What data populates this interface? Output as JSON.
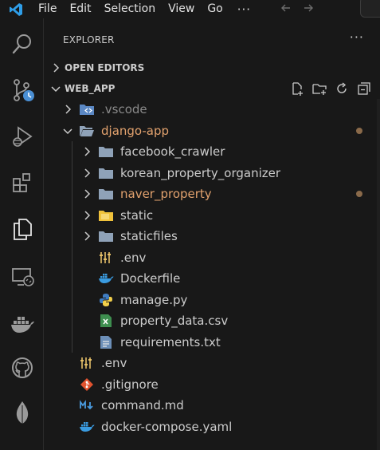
{
  "menu": {
    "items": [
      "File",
      "Edit",
      "Selection",
      "View",
      "Go"
    ],
    "more": "···",
    "back_icon": "arrow-left-icon",
    "forward_icon": "arrow-right-icon"
  },
  "activity_bar": {
    "items": [
      "search-icon",
      "source-control-icon",
      "run-debug-icon",
      "extensions-icon",
      "explorer-icon",
      "remote-explorer-icon",
      "docker-icon",
      "github-icon",
      "mongodb-icon"
    ]
  },
  "sidebar": {
    "title": "EXPLORER",
    "more": "···",
    "open_editors": "OPEN EDITORS",
    "workspace": "WEB_APP"
  },
  "tree": [
    {
      "label": ".vscode",
      "icon": "vscode-folder-icon",
      "depth": 1,
      "type": "folder",
      "expanded": false,
      "style": "dim"
    },
    {
      "label": "django-app",
      "icon": "folder-open-icon",
      "depth": 1,
      "type": "folder",
      "expanded": true,
      "style": "modified",
      "dot": true
    },
    {
      "label": "facebook_crawler",
      "icon": "folder-icon",
      "depth": 2,
      "type": "folder",
      "expanded": false
    },
    {
      "label": "korean_property_organizer",
      "icon": "folder-icon",
      "depth": 2,
      "type": "folder",
      "expanded": false
    },
    {
      "label": "naver_property",
      "icon": "folder-icon",
      "depth": 2,
      "type": "folder",
      "expanded": false,
      "style": "modified",
      "dot": true
    },
    {
      "label": "static",
      "icon": "static-folder-icon",
      "depth": 2,
      "type": "folder",
      "expanded": false
    },
    {
      "label": "staticfiles",
      "icon": "folder-icon",
      "depth": 2,
      "type": "folder",
      "expanded": false
    },
    {
      "label": ".env",
      "icon": "env-icon",
      "depth": 2,
      "type": "file"
    },
    {
      "label": "Dockerfile",
      "icon": "docker-file-icon",
      "depth": 2,
      "type": "file"
    },
    {
      "label": "manage.py",
      "icon": "python-icon",
      "depth": 2,
      "type": "file"
    },
    {
      "label": "property_data.csv",
      "icon": "csv-icon",
      "depth": 2,
      "type": "file"
    },
    {
      "label": "requirements.txt",
      "icon": "text-file-icon",
      "depth": 2,
      "type": "file"
    },
    {
      "label": ".env",
      "icon": "env-icon",
      "depth": 1,
      "type": "file"
    },
    {
      "label": ".gitignore",
      "icon": "git-icon",
      "depth": 1,
      "type": "file"
    },
    {
      "label": "command.md",
      "icon": "markdown-icon",
      "depth": 1,
      "type": "file"
    },
    {
      "label": "docker-compose.yaml",
      "icon": "docker-file-icon",
      "depth": 1,
      "type": "file"
    }
  ],
  "colors": {
    "background": "#181818",
    "modified": "#e2a26e",
    "folder": "#8fa2b8",
    "accent": "#0078d4"
  }
}
